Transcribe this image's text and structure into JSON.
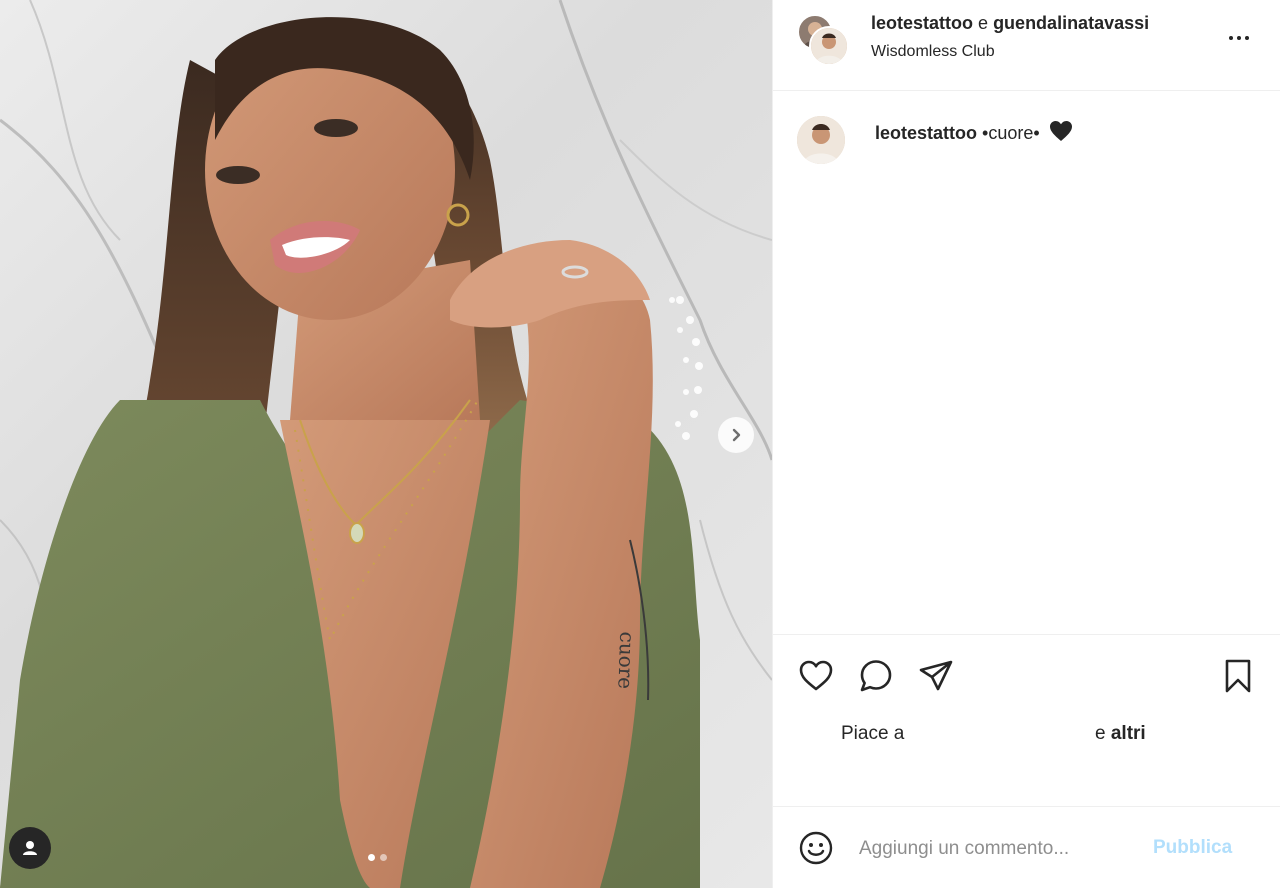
{
  "post": {
    "author": "leotestattoo",
    "conjunction": "e",
    "collaborator": "guendalinatavassi",
    "location": "Wisdomless Club"
  },
  "caption": {
    "username": "leotestattoo",
    "text": "•cuore•",
    "emoji": "black-heart"
  },
  "likes": {
    "prefix": "Piace a",
    "conjunction": "e",
    "others": "altri"
  },
  "comment_box": {
    "placeholder": "Aggiungi un commento...",
    "publish_label": "Pubblica"
  },
  "carousel": {
    "slides": 2,
    "active": 1
  },
  "icons": {
    "like": "heart-outline-icon",
    "comment": "comment-bubble-icon",
    "share": "paper-plane-icon",
    "save": "bookmark-icon",
    "more": "three-dots-icon",
    "emoji": "smiley-icon",
    "next": "chevron-right-icon",
    "user_tags": "user-icon"
  },
  "colors": {
    "text": "#262626",
    "muted": "#8e8e8e",
    "publish_disabled": "#b2dffc",
    "border": "#efefef"
  }
}
